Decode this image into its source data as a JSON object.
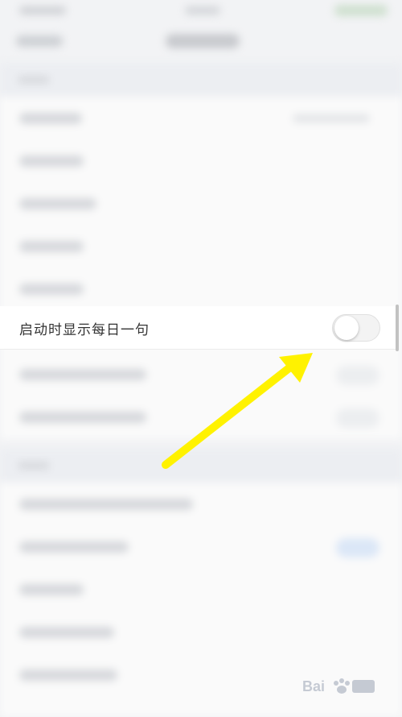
{
  "setting_row": {
    "label": "启动时显示每日一句",
    "toggle_state": "off"
  },
  "annotation": {
    "arrow_color": "#FFF200"
  },
  "colors": {
    "background": "#f2f3f5",
    "row_background": "#ffffff",
    "label_text": "#333333",
    "toggle_track": "#f3f3f3"
  }
}
